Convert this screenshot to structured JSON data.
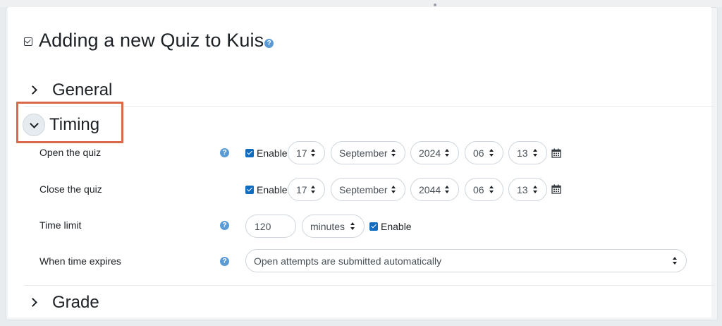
{
  "page": {
    "title": "Adding a new Quiz to Kuis"
  },
  "icons": {
    "help": "?",
    "title_check": "checkbox-icon",
    "chevron_right": "chevron-right-icon",
    "chevron_down": "chevron-down-icon",
    "calendar": "calendar-icon"
  },
  "colors": {
    "accent": "#0f6cbf",
    "help": "#5b9bd5",
    "highlight": "#d9694b"
  },
  "sections": {
    "general": {
      "label": "General",
      "expanded": false
    },
    "timing": {
      "label": "Timing",
      "expanded": true
    },
    "grade": {
      "label": "Grade",
      "expanded": false
    }
  },
  "timing": {
    "open": {
      "label": "Open the quiz",
      "enable_label": "Enable",
      "enabled": true,
      "day": "17",
      "month": "September",
      "year": "2024",
      "hour": "06",
      "minute": "13"
    },
    "close": {
      "label": "Close the quiz",
      "enable_label": "Enable",
      "enabled": true,
      "day": "17",
      "month": "September",
      "year": "2044",
      "hour": "06",
      "minute": "13"
    },
    "time_limit": {
      "label": "Time limit",
      "value": "120",
      "unit": "minutes",
      "enable_label": "Enable",
      "enabled": true
    },
    "when_expires": {
      "label": "When time expires",
      "value": "Open attempts are submitted automatically"
    }
  }
}
